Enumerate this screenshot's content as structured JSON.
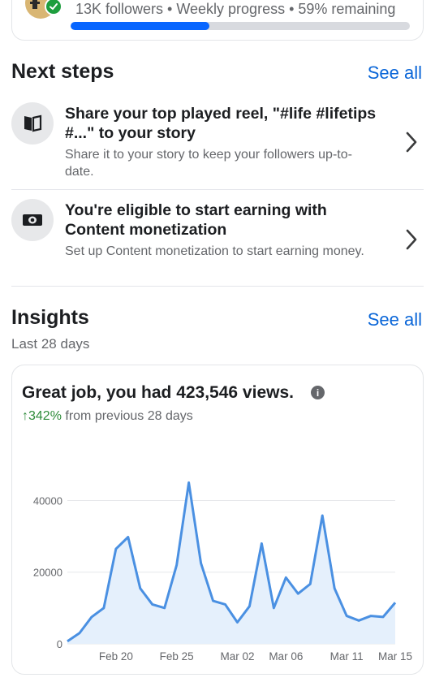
{
  "progress_card": {
    "summary": "13K followers • Weekly progress • 59% remaining",
    "progress_fraction": 0.41
  },
  "next_steps": {
    "title": "Next steps",
    "see_all": "See all",
    "items": [
      {
        "title": "Share your top played reel, \"#life #lifetips #...\" to your story",
        "subtitle": "Share it to your story to keep your followers up-to-date.",
        "icon": "book-open-icon"
      },
      {
        "title": "You're eligible to start earning with Content monetization",
        "subtitle": "Set up Content monetization to start earning money.",
        "icon": "money-icon"
      }
    ]
  },
  "insights": {
    "title": "Insights",
    "see_all": "See all",
    "period": "Last 28 days",
    "card": {
      "headline": "Great job, you had 423,546 views.",
      "change_pct": "↑342%",
      "change_text": " from previous 28 days"
    }
  },
  "colors": {
    "accent": "#0866ff",
    "link": "#0a66d8",
    "positive": "#2e8b3a",
    "line": "#4a90e2",
    "area": "#e5f0fc"
  },
  "chart_data": {
    "type": "area",
    "x_ticks": [
      "Feb 20",
      "Feb 25",
      "Mar 02",
      "Mar 06",
      "Mar 11",
      "Mar 15"
    ],
    "y_ticks": [
      "0",
      "20000",
      "40000"
    ],
    "ylim": [
      0,
      46000
    ],
    "x": [
      "Feb 16",
      "Feb 17",
      "Feb 18",
      "Feb 19",
      "Feb 20",
      "Feb 21",
      "Feb 22",
      "Feb 23",
      "Feb 24",
      "Feb 25",
      "Feb 26",
      "Feb 27",
      "Feb 28",
      "Mar 01",
      "Mar 02",
      "Mar 03",
      "Mar 04",
      "Mar 05",
      "Mar 06",
      "Mar 07",
      "Mar 08",
      "Mar 09",
      "Mar 10",
      "Mar 11",
      "Mar 12",
      "Mar 13",
      "Mar 14",
      "Mar 15"
    ],
    "values": [
      700,
      3000,
      7500,
      10000,
      26500,
      29800,
      15500,
      11000,
      10000,
      22000,
      45000,
      22500,
      12000,
      11000,
      6000,
      10500,
      28000,
      10000,
      18500,
      14000,
      16700,
      35800,
      15500,
      7800,
      6500,
      7800,
      7500,
      11500
    ],
    "grid": true
  }
}
